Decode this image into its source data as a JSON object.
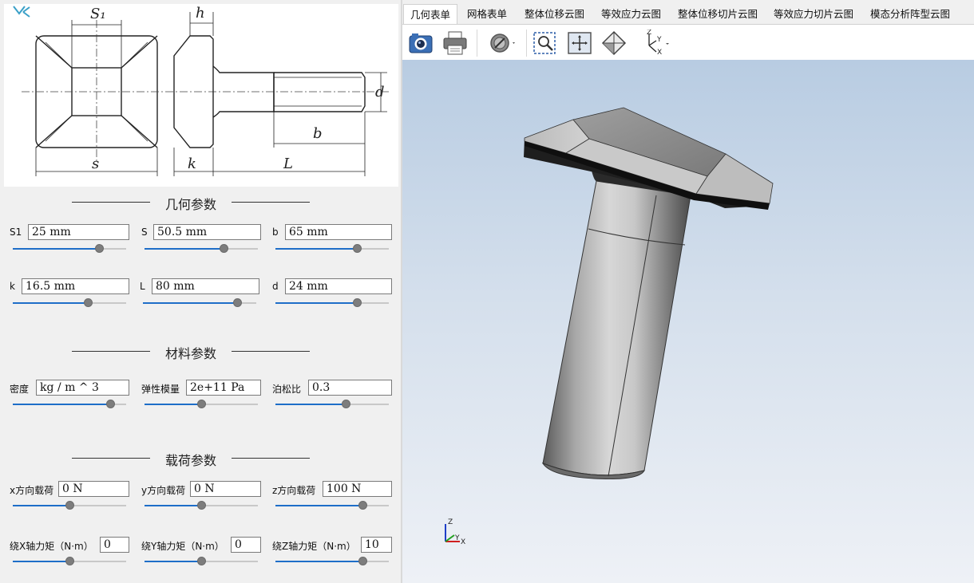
{
  "drawing": {
    "s1_label": "S₁",
    "h_label": "h",
    "d_label": "d",
    "b_label": "b",
    "s_label": "s",
    "k_label": "k",
    "l_label": "L"
  },
  "sections": {
    "geometry": "几何参数",
    "material": "材料参数",
    "load": "载荷参数"
  },
  "geometry": {
    "s1": {
      "label": "S1",
      "value": "25 mm",
      "slider": 0.76
    },
    "s": {
      "label": "S",
      "value": "50.5 mm",
      "slider": 0.7
    },
    "b": {
      "label": "b",
      "value": "65 mm",
      "slider": 0.72
    },
    "k": {
      "label": "k",
      "value": "16.5 mm",
      "slider": 0.66
    },
    "l": {
      "label": "L",
      "value": "80 mm",
      "slider": 0.83
    },
    "d": {
      "label": "d",
      "value": "24 mm",
      "slider": 0.72
    }
  },
  "material": {
    "density": {
      "label": "密度",
      "value": "kg / m ^ 3",
      "slider": 0.86
    },
    "elastic": {
      "label": "弹性模量",
      "value": "2e+11 Pa",
      "slider": 0.5
    },
    "poisson": {
      "label": "泊松比",
      "value": "0.3",
      "slider": 0.62
    }
  },
  "load": {
    "fx": {
      "label": "x方向载荷",
      "value": "0 N",
      "slider": 0.5
    },
    "fy": {
      "label": "y方向载荷",
      "value": "0 N",
      "slider": 0.5
    },
    "fz": {
      "label": "z方向载荷",
      "value": "100 N",
      "slider": 0.77
    },
    "mx": {
      "label": "绕X轴力矩（N·m）",
      "value": "0",
      "slider": 0.5
    },
    "my": {
      "label": "绕Y轴力矩（N·m）",
      "value": "0",
      "slider": 0.5
    },
    "mz": {
      "label": "绕Z轴力矩（N·m）",
      "value": "10",
      "slider": 0.77
    }
  },
  "tabs": [
    {
      "label": "几何表单",
      "active": true
    },
    {
      "label": "网格表单",
      "active": false
    },
    {
      "label": "整体位移云图",
      "active": false
    },
    {
      "label": "等效应力云图",
      "active": false
    },
    {
      "label": "整体位移切片云图",
      "active": false
    },
    {
      "label": "等效应力切片云图",
      "active": false
    },
    {
      "label": "模态分析阵型云图",
      "active": false
    }
  ],
  "toolbar": {
    "icons": [
      "camera-icon",
      "printer-icon",
      "clip-plane-icon",
      "zoom-box-icon",
      "fit-view-icon",
      "view-orientation-icon",
      "axis-view-icon"
    ]
  },
  "axes": {
    "z": "Z",
    "y": "Y",
    "x": "X"
  },
  "colors": {
    "slider_fill": "#1e6ec8",
    "viewport_top": "#b8cce2",
    "viewport_bottom": "#eef1f6",
    "model": "#a9a9a9"
  }
}
